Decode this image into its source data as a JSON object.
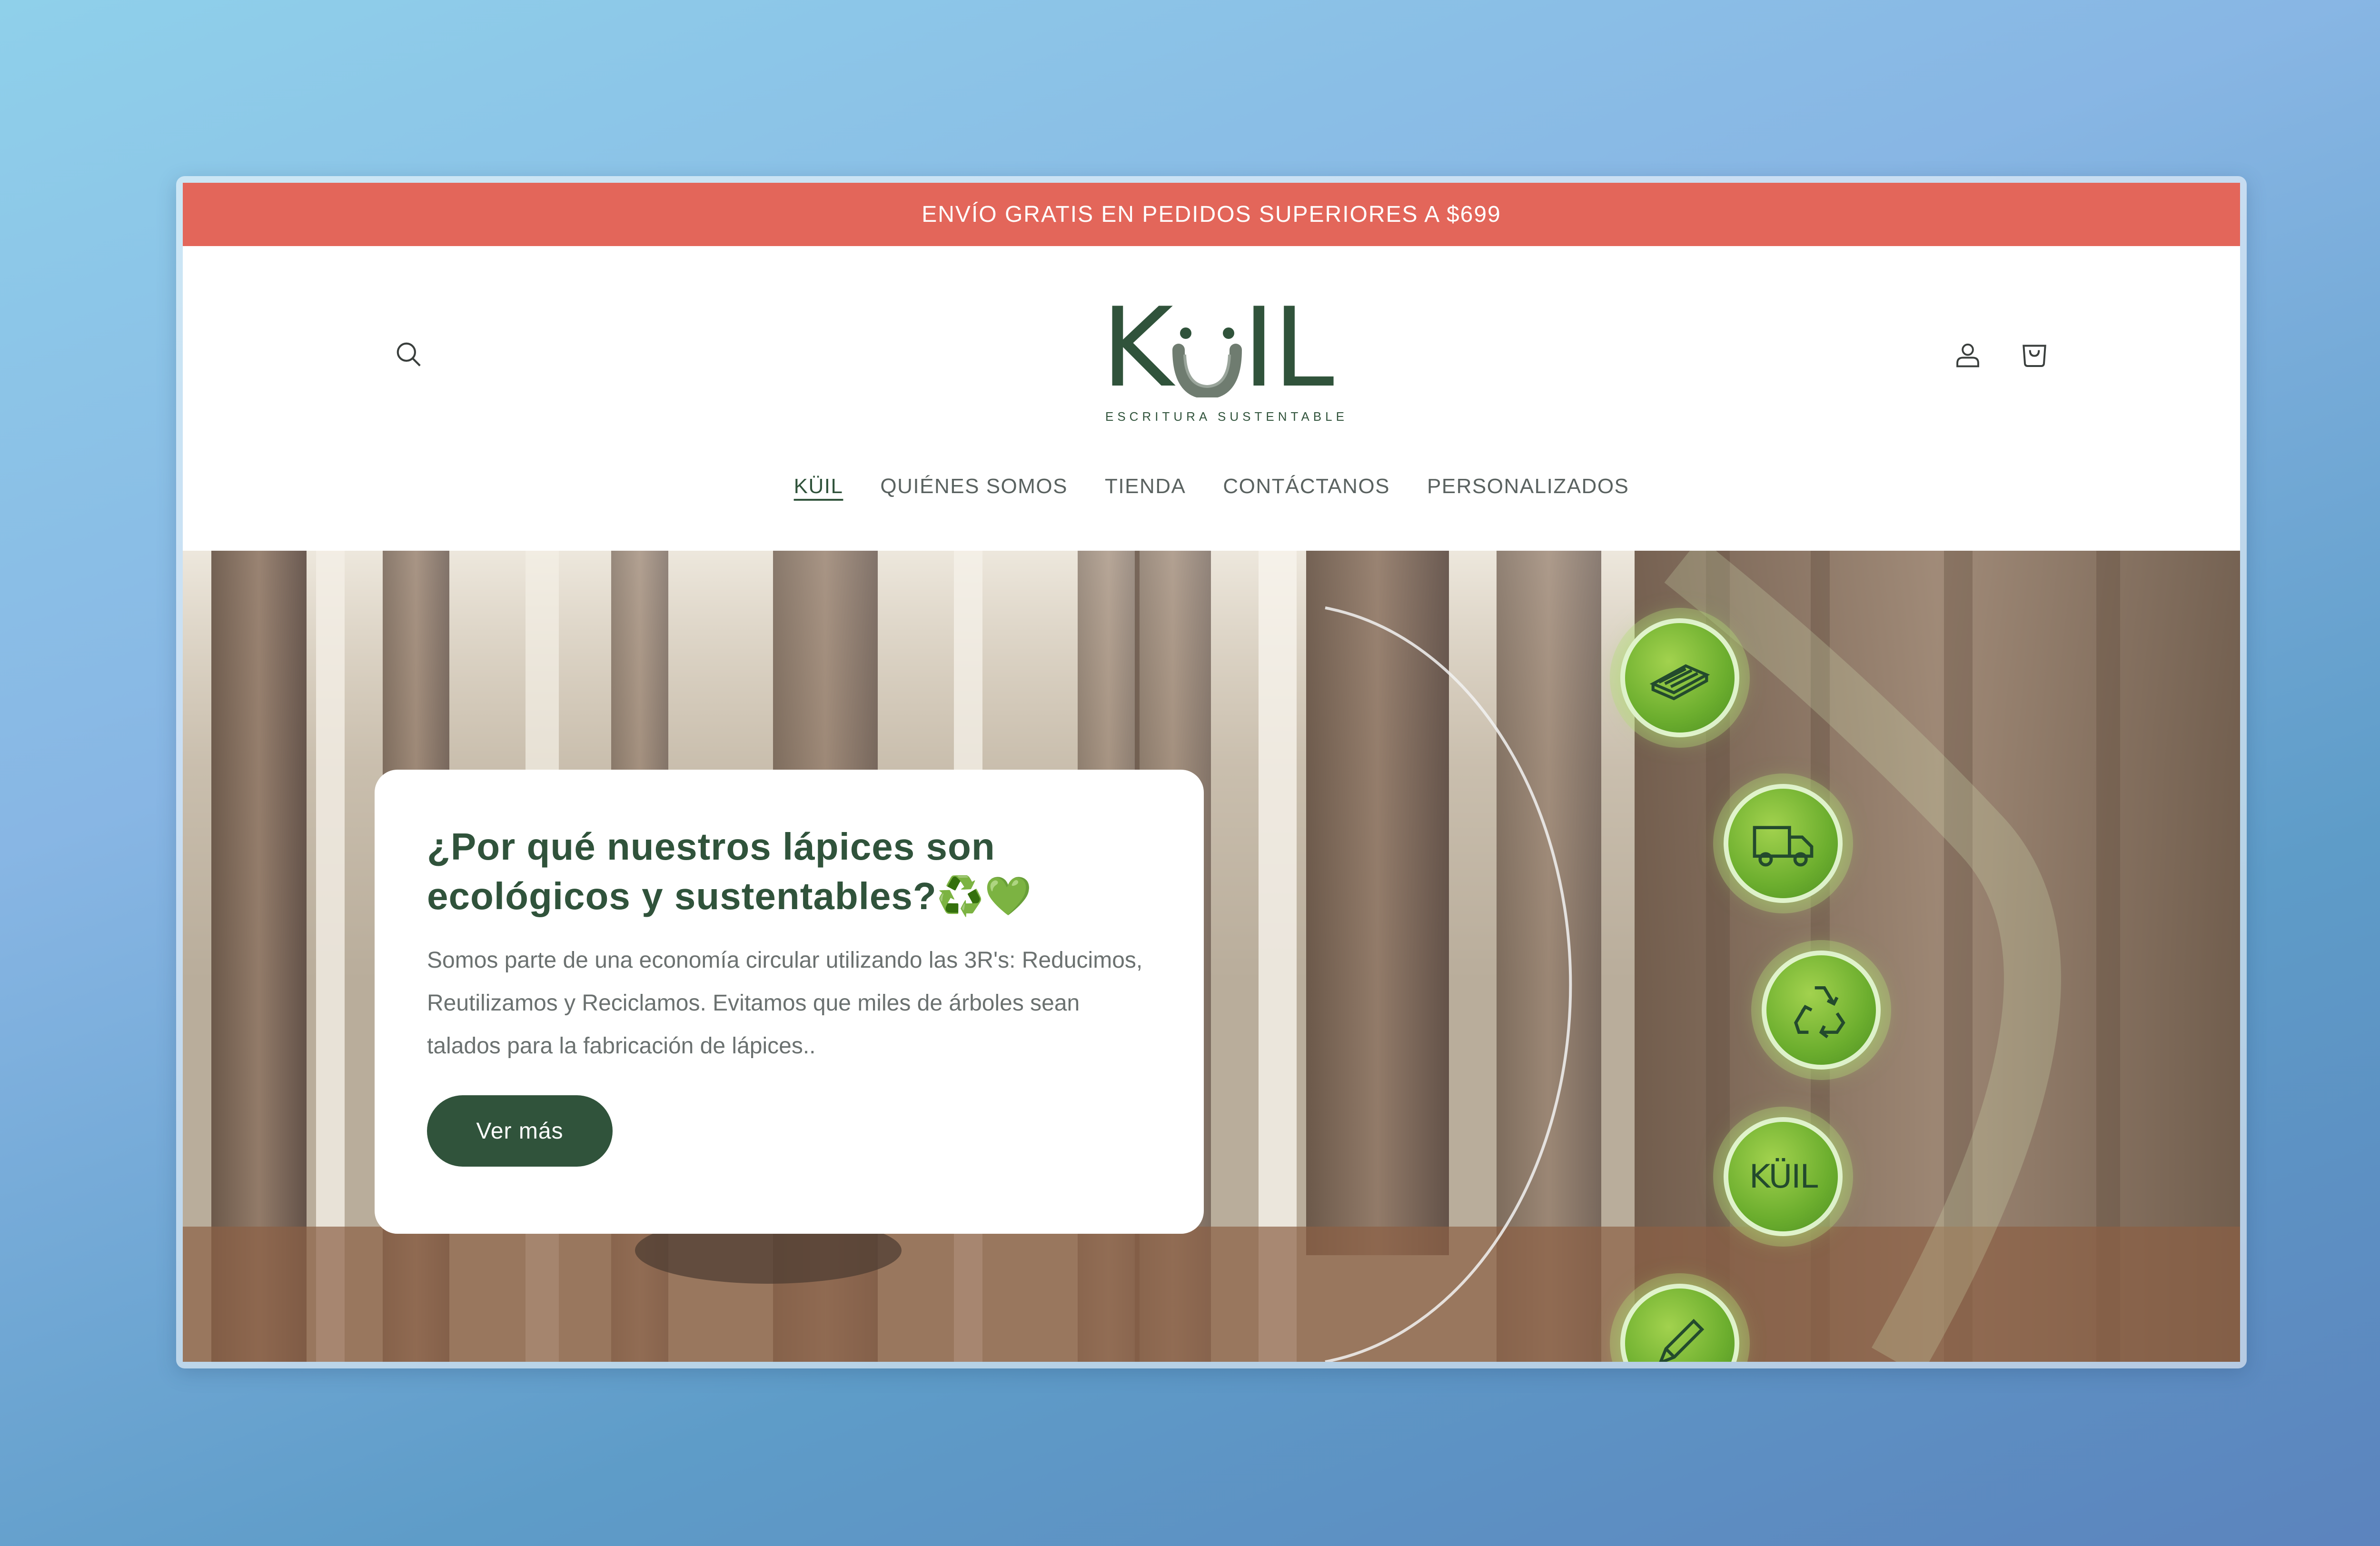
{
  "announcement": {
    "text": "ENVÍO GRATIS EN PEDIDOS SUPERIORES A $699"
  },
  "header": {
    "logo": {
      "word": "KÜIL",
      "tagline": "ESCRITURA SUSTENTABLE"
    },
    "icons": {
      "search": "search-icon",
      "account": "user-icon",
      "cart": "cart-icon"
    }
  },
  "nav": {
    "items": [
      {
        "label": "KÜIL",
        "active": true
      },
      {
        "label": "QUIÉNES SOMOS"
      },
      {
        "label": "TIENDA"
      },
      {
        "label": "CONTÁCTANOS"
      },
      {
        "label": "PERSONALIZADOS"
      }
    ]
  },
  "hero": {
    "title": "¿Por qué nuestros lápices son ecológicos y sustentables?♻️💚",
    "body": "Somos parte de una economía circular utilizando las 3R's: Reducimos, Reutilizamos y Reciclamos. Evitamos que miles de árboles sean talados para la fabricación de lápices..",
    "cta": "Ver más",
    "badges": [
      {
        "icon": "paper-stack-icon"
      },
      {
        "icon": "delivery-truck-icon"
      },
      {
        "icon": "recycle-icon"
      },
      {
        "icon": "kuil-logo-badge",
        "text": "KÜIL"
      },
      {
        "icon": "pencil-icon"
      }
    ]
  },
  "colors": {
    "announcement_bg": "#e3665a",
    "brand_green": "#30533b",
    "badge_green": "#6cae2e"
  }
}
